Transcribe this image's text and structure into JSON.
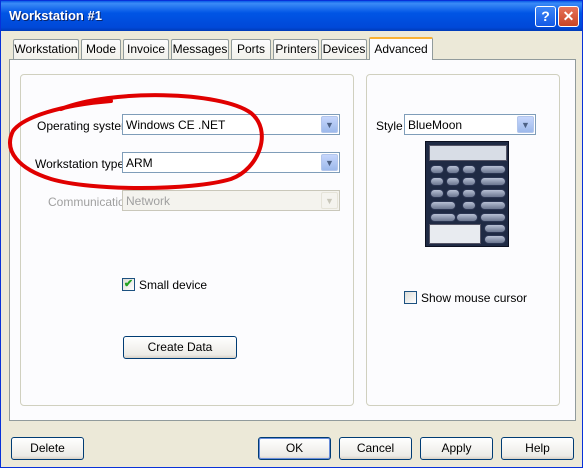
{
  "window": {
    "title": "Workstation #1"
  },
  "titlebar": {
    "help_glyph": "?",
    "close_glyph": "✕"
  },
  "tabs": [
    {
      "label": "Workstation"
    },
    {
      "label": "Mode"
    },
    {
      "label": "Invoice"
    },
    {
      "label": "Messages"
    },
    {
      "label": "Ports"
    },
    {
      "label": "Printers"
    },
    {
      "label": "Devices"
    },
    {
      "label": "Advanced",
      "active": true
    }
  ],
  "advanced": {
    "os_label": "Operating system",
    "os_value": "Windows CE .NET",
    "type_label": "Workstation type",
    "type_value": "ARM",
    "comm_label": "Communication",
    "comm_value": "Network",
    "small_device_label": "Small device",
    "small_device_checked": true,
    "create_data_label": "Create Data",
    "style_label": "Style",
    "style_value": "BlueMoon",
    "show_cursor_label": "Show mouse cursor",
    "show_cursor_checked": false
  },
  "footer": {
    "delete_label": "Delete",
    "ok_label": "OK",
    "cancel_label": "Cancel",
    "apply_label": "Apply",
    "help_label": "Help"
  },
  "colors": {
    "titlebar": "#0055e5",
    "annotation": "#e00000",
    "active_tab_accent": "#f9b233"
  },
  "icons": [
    "help-icon",
    "close-icon",
    "dropdown-arrow-icon",
    "checkmark-icon"
  ]
}
